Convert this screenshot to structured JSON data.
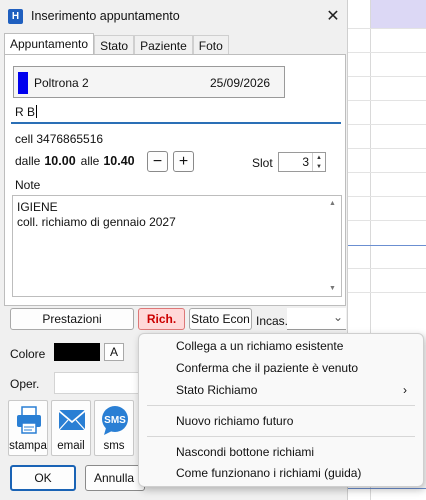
{
  "window": {
    "title": "Inserimento appuntamento",
    "app_icon_letter": "H"
  },
  "tabs": [
    {
      "label": "Appuntamento",
      "active": true
    },
    {
      "label": "Stato",
      "active": false
    },
    {
      "label": "Paziente",
      "active": false
    },
    {
      "label": "Foto",
      "active": false
    }
  ],
  "chair": {
    "name": "Poltrona 2",
    "date": "25/09/2026",
    "color": "#0000ee"
  },
  "patient": {
    "value": "R B"
  },
  "cell_line": "cell 3476865516",
  "time": {
    "from_label": "dalle",
    "from": "10.00",
    "to_label": "alle",
    "to": "10.40",
    "minus": "−",
    "plus": "+"
  },
  "slot": {
    "label": "Slot",
    "value": "3"
  },
  "notes": {
    "label": "Note",
    "text": "IGIENE\ncoll. richiamo di gennaio 2027"
  },
  "actions": {
    "prestazioni": "Prestazioni",
    "rich": "Rich.",
    "stato_econ": "Stato Econ",
    "incas_label": "Incas."
  },
  "colore": {
    "label": "Colore",
    "value": "#000000",
    "a_button": "A"
  },
  "oper": {
    "label": "Oper."
  },
  "tools": [
    {
      "label": "stampa",
      "icon": "printer-icon"
    },
    {
      "label": "email",
      "icon": "envelope-icon"
    },
    {
      "label": "sms",
      "icon": "sms-icon",
      "badge": "SMS"
    }
  ],
  "bottom": {
    "ok": "OK",
    "annulla": "Annulla"
  },
  "menu": {
    "items": [
      {
        "label": "Collega a un richiamo esistente"
      },
      {
        "label": "Conferma che il paziente è venuto"
      },
      {
        "label": "Stato Richiamo",
        "submenu": "›"
      },
      {
        "label": "Nuovo richiamo futuro"
      },
      {
        "label": "Nascondi bottone richiami"
      },
      {
        "label": "Come funzionano i richiami (guida)"
      }
    ]
  },
  "colors": {
    "accent": "#1a63b5",
    "rich_bg": "#ffd9d9",
    "rich_text": "#cc0000"
  }
}
